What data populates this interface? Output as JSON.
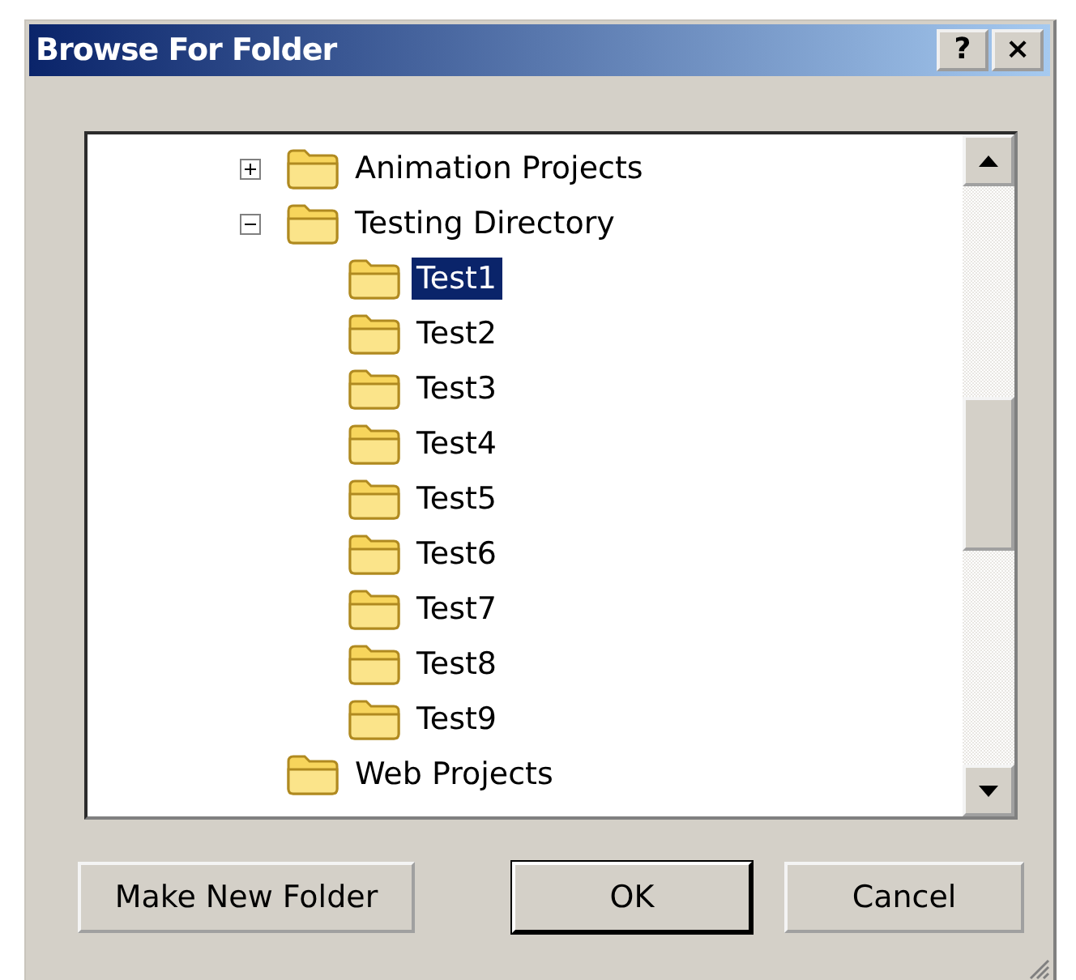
{
  "window": {
    "title": "Browse For Folder",
    "title_buttons": [
      "?",
      "×"
    ]
  },
  "tree": [
    {
      "label": "Animation Projects",
      "expanded": false,
      "selected": false
    },
    {
      "label": "Testing Directory",
      "expanded": true,
      "selected": false,
      "children": [
        {
          "label": "Test1",
          "selected": true
        },
        {
          "label": "Test2",
          "selected": false
        },
        {
          "label": "Test3",
          "selected": false
        },
        {
          "label": "Test4",
          "selected": false
        },
        {
          "label": "Test5",
          "selected": false
        },
        {
          "label": "Test6",
          "selected": false
        },
        {
          "label": "Test7",
          "selected": false
        },
        {
          "label": "Test8",
          "selected": false
        },
        {
          "label": "Test9",
          "selected": false
        }
      ]
    },
    {
      "label": "Web Projects",
      "selected": false
    }
  ],
  "buttons": [
    {
      "label": "Make New Folder",
      "default": false
    },
    {
      "label": "OK",
      "default": true
    },
    {
      "label": "Cancel",
      "default": false
    }
  ]
}
